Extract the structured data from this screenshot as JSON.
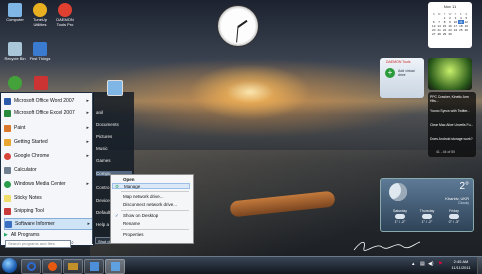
{
  "desktop": {
    "icons": [
      {
        "name": "computer-icon",
        "label": "Computer",
        "color": "#7fb6e6"
      },
      {
        "name": "tuneup-icon",
        "label": "TuneUp Utilities",
        "color": "#e8b020"
      },
      {
        "name": "daemon-tools-icon",
        "label": "DAEMON Tools Pro",
        "color": "#e04030"
      },
      {
        "name": "recycle-bin-icon",
        "label": "Recycle Bin",
        "color": "#a9c7d9"
      },
      {
        "name": "first-things-icon",
        "label": "First Things",
        "color": "#3a7bd0"
      },
      {
        "name": "utorrent-icon",
        "label": "uTorrent",
        "color": "#44a23a"
      },
      {
        "name": "ccleaner-icon",
        "label": "",
        "color": "#cc3333"
      }
    ]
  },
  "start_menu": {
    "programs": [
      {
        "label": "Microsoft Office Word 2007",
        "color": "#2b5aa8",
        "arrow": true
      },
      {
        "label": "Microsoft Office Excel 2007",
        "color": "#2a8a3b",
        "arrow": true
      },
      {
        "label": "Paint",
        "color": "#d9782a",
        "arrow": true
      },
      {
        "label": "Getting Started",
        "color": "#e8a530",
        "arrow": true
      },
      {
        "label": "Google Chrome",
        "color": "#d8443a",
        "arrow": true
      },
      {
        "label": "Calculator",
        "color": "#6f7f8f",
        "arrow": false
      },
      {
        "label": "Windows Media Center",
        "color": "#2a9d4a",
        "arrow": true
      },
      {
        "label": "Sticky Notes",
        "color": "#f0dd6a",
        "arrow": false
      },
      {
        "label": "Snipping Tool",
        "color": "#c93a3a",
        "arrow": false
      },
      {
        "label": "Software Informer",
        "color": "#3b6fc2",
        "arrow": true
      }
    ],
    "all_programs": "All Programs",
    "search_placeholder": "Search programs and files",
    "right_items": [
      "anil",
      "Documents",
      "Pictures",
      "Music",
      "Games",
      "Compu",
      "Contro",
      "Devices",
      "Default",
      "Help a"
    ],
    "shutdown_label": "Shut down",
    "user_picture_color": "#7fb6e6"
  },
  "context_menu": {
    "items": [
      "Open",
      "Manage",
      "Map network drive...",
      "Disconnect network drive...",
      "Show on Desktop",
      "Rename",
      "Properties"
    ],
    "checked": "Show on Desktop",
    "selected": "Manage"
  },
  "calendar": {
    "month": "Nov 11",
    "days": [
      "S",
      "M",
      "T",
      "W",
      "T",
      "F",
      "S"
    ],
    "dates": [
      "",
      "",
      "1",
      "2",
      "3",
      "4",
      "5",
      "6",
      "7",
      "8",
      "9",
      "10",
      "11",
      "12",
      "13",
      "14",
      "15",
      "16",
      "17",
      "18",
      "19",
      "20",
      "21",
      "22",
      "23",
      "24",
      "25",
      "26",
      "27",
      "28",
      "29",
      "30"
    ],
    "today": "11"
  },
  "gadget_add": {
    "title": "Add virtual drive",
    "brand": "DAEMON Tools"
  },
  "feed": {
    "items": [
      "PPC Crasher, Kinetic Arm Hits...",
      "Yoono Syncs with Twitter...",
      "Clear Mac Alive Unveils Fu...",
      "Does Android storage work?"
    ],
    "counter": "41 - 44 of 50"
  },
  "weather": {
    "temp": "2°",
    "city": "Kharkiv, UKR",
    "condition": "Cloudy",
    "forecast": [
      {
        "day": "Saturday",
        "t": "1° / -2°"
      },
      {
        "day": "Thursday",
        "t": "1° / -2°"
      },
      {
        "day": "Friday",
        "t": "0° / -3°"
      }
    ]
  },
  "taskbar": {
    "time": "2:45 AM",
    "date": "11/11/2011",
    "colors": [
      "#2c6ad1",
      "#e85a12",
      "#c2702a",
      "#4d8ed8",
      "#5fa0e0"
    ]
  }
}
